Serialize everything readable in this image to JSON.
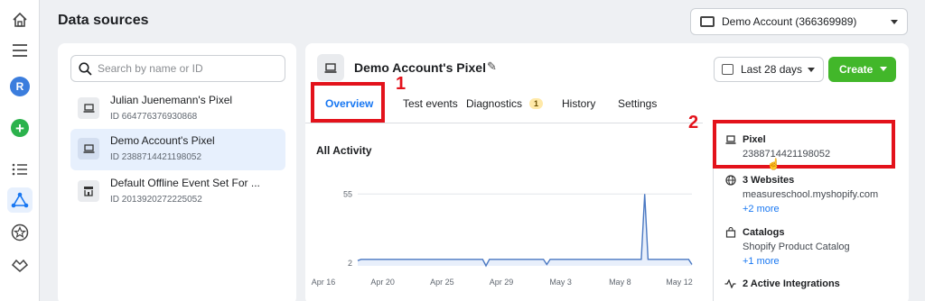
{
  "colors": {
    "accent": "#1877f2",
    "create_green": "#42b72a",
    "annotation_red": "#e3121b",
    "selected_row": "#e7f0fd"
  },
  "rail": {
    "icons": [
      "home-icon",
      "menu-icon",
      "avatar",
      "add-icon",
      "list-icon",
      "events-manager-icon",
      "star-icon",
      "partner-icon"
    ],
    "avatar_letter": "R"
  },
  "header": {
    "title": "Data sources",
    "account_label": "Demo Account (366369989)"
  },
  "search": {
    "placeholder": "Search by name or ID"
  },
  "sources": [
    {
      "name": "Julian Juenemann's Pixel",
      "id": "ID 664776376930868",
      "icon": "pixel-icon",
      "selected": false
    },
    {
      "name": "Demo Account's Pixel",
      "id": "ID 2388714421198052",
      "icon": "pixel-icon",
      "selected": true
    },
    {
      "name": "Default Offline Event Set For ...",
      "id": "ID 2013920272225052",
      "icon": "store-icon",
      "selected": false
    }
  ],
  "detail": {
    "title": "Demo Account's Pixel",
    "date_range": "Last 28 days",
    "create_label": "Create",
    "tabs": [
      {
        "label": "Overview",
        "active": true
      },
      {
        "label": "Test events",
        "active": false
      },
      {
        "label": "Diagnostics",
        "active": false,
        "badge": "1"
      },
      {
        "label": "History",
        "active": false
      },
      {
        "label": "Settings",
        "active": false
      }
    ],
    "activity_title": "All Activity"
  },
  "side": {
    "pixel_label": "Pixel",
    "pixel_id": "2388714421198052",
    "websites_label": "3 Websites",
    "website": "measureschool.myshopify.com",
    "websites_more": "+2 more",
    "catalogs_label": "Catalogs",
    "catalog": "Shopify Product Catalog",
    "catalogs_more": "+1 more",
    "integrations_label": "2 Active Integrations"
  },
  "annotations": {
    "one": "1",
    "two": "2"
  },
  "chart_data": {
    "type": "line",
    "title": "All Activity",
    "xlabel": "",
    "ylabel": "",
    "y_ticks": [
      2,
      55
    ],
    "ylim": [
      0,
      60
    ],
    "x_tick_labels": [
      "Apr 16",
      "Apr 20",
      "Apr 25",
      "Apr 29",
      "May 3",
      "May 8",
      "May 12"
    ],
    "grid": "horizontal",
    "series": [
      {
        "values": [
          4,
          5,
          5,
          5,
          5,
          5,
          5,
          5,
          5,
          5,
          5,
          5,
          5,
          5,
          5,
          5,
          5,
          5,
          5,
          5,
          5,
          5,
          5,
          5,
          5,
          5,
          5,
          5,
          5,
          5,
          5,
          5,
          5,
          5,
          5,
          5,
          5,
          5,
          0,
          5,
          5,
          5,
          5,
          5,
          5,
          5,
          5,
          5,
          5,
          5,
          5,
          5,
          5,
          5,
          5,
          5,
          1,
          5,
          5,
          5,
          5,
          5,
          5,
          5,
          5,
          5,
          5,
          5,
          5,
          5,
          5,
          5,
          5,
          5,
          5,
          5,
          5,
          5,
          5,
          5,
          5,
          5,
          5,
          5,
          5,
          55,
          5,
          5,
          5,
          5,
          5,
          5,
          5,
          5,
          5,
          5,
          5,
          5,
          5,
          1
        ]
      }
    ]
  }
}
